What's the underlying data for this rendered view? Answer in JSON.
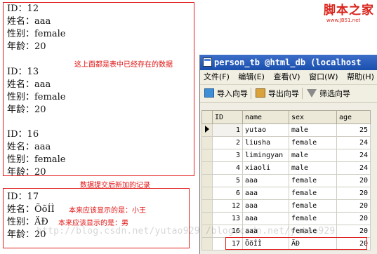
{
  "logo": {
    "title": "脚本之家",
    "url": "www.JB51.net"
  },
  "records_saved": [
    {
      "id": "ID：12",
      "name": "姓名：aaa",
      "gender": "性别：female",
      "age": "年龄：20"
    },
    {
      "id": "ID：13",
      "name": "姓名：aaa",
      "gender": "性别：female",
      "age": "年龄：20"
    },
    {
      "id": "ID：16",
      "name": "姓名：aaa",
      "gender": "性别：female",
      "age": "年龄：20"
    }
  ],
  "note_saved": "这上面都是表中已经存在的数据",
  "note_new": "数据提交后新加的记录",
  "record_new": {
    "id": "ID：17",
    "name": "姓名：ÕõÍÌ",
    "gender": "性别：ÄÐ",
    "age": "年龄：20"
  },
  "note_name": "本来应该显示的是：小王",
  "note_gender": "本来应该显示的是：男",
  "window": {
    "title": "person_tb @html_db (localhost",
    "menu": [
      "文件(F)",
      "编辑(E)",
      "查看(V)",
      "窗口(W)",
      "帮助(H)"
    ],
    "toolbar": [
      "导入向导",
      "导出向导",
      "筛选向导"
    ]
  },
  "table": {
    "columns": [
      "ID",
      "name",
      "sex",
      "age"
    ],
    "rows": [
      {
        "id": "1",
        "name": "yutao",
        "sex": "male",
        "age": "25"
      },
      {
        "id": "2",
        "name": "liusha",
        "sex": "female",
        "age": "24"
      },
      {
        "id": "3",
        "name": "limingyan",
        "sex": "male",
        "age": "24"
      },
      {
        "id": "4",
        "name": "xiaoli",
        "sex": "male",
        "age": "24"
      },
      {
        "id": "5",
        "name": "aaa",
        "sex": "female",
        "age": "20"
      },
      {
        "id": "6",
        "name": "aaa",
        "sex": "female",
        "age": "20"
      },
      {
        "id": "12",
        "name": "aaa",
        "sex": "female",
        "age": "20"
      },
      {
        "id": "13",
        "name": "aaa",
        "sex": "female",
        "age": "20"
      },
      {
        "id": "16",
        "name": "aaa",
        "sex": "female",
        "age": "20"
      },
      {
        "id": "17",
        "name": "ÕõÍÌ",
        "sex": "ÄÐ",
        "age": "20"
      }
    ]
  },
  "watermark": "http://blog.csdn.net/yutao929 /blog.csdn.net/yutao929"
}
